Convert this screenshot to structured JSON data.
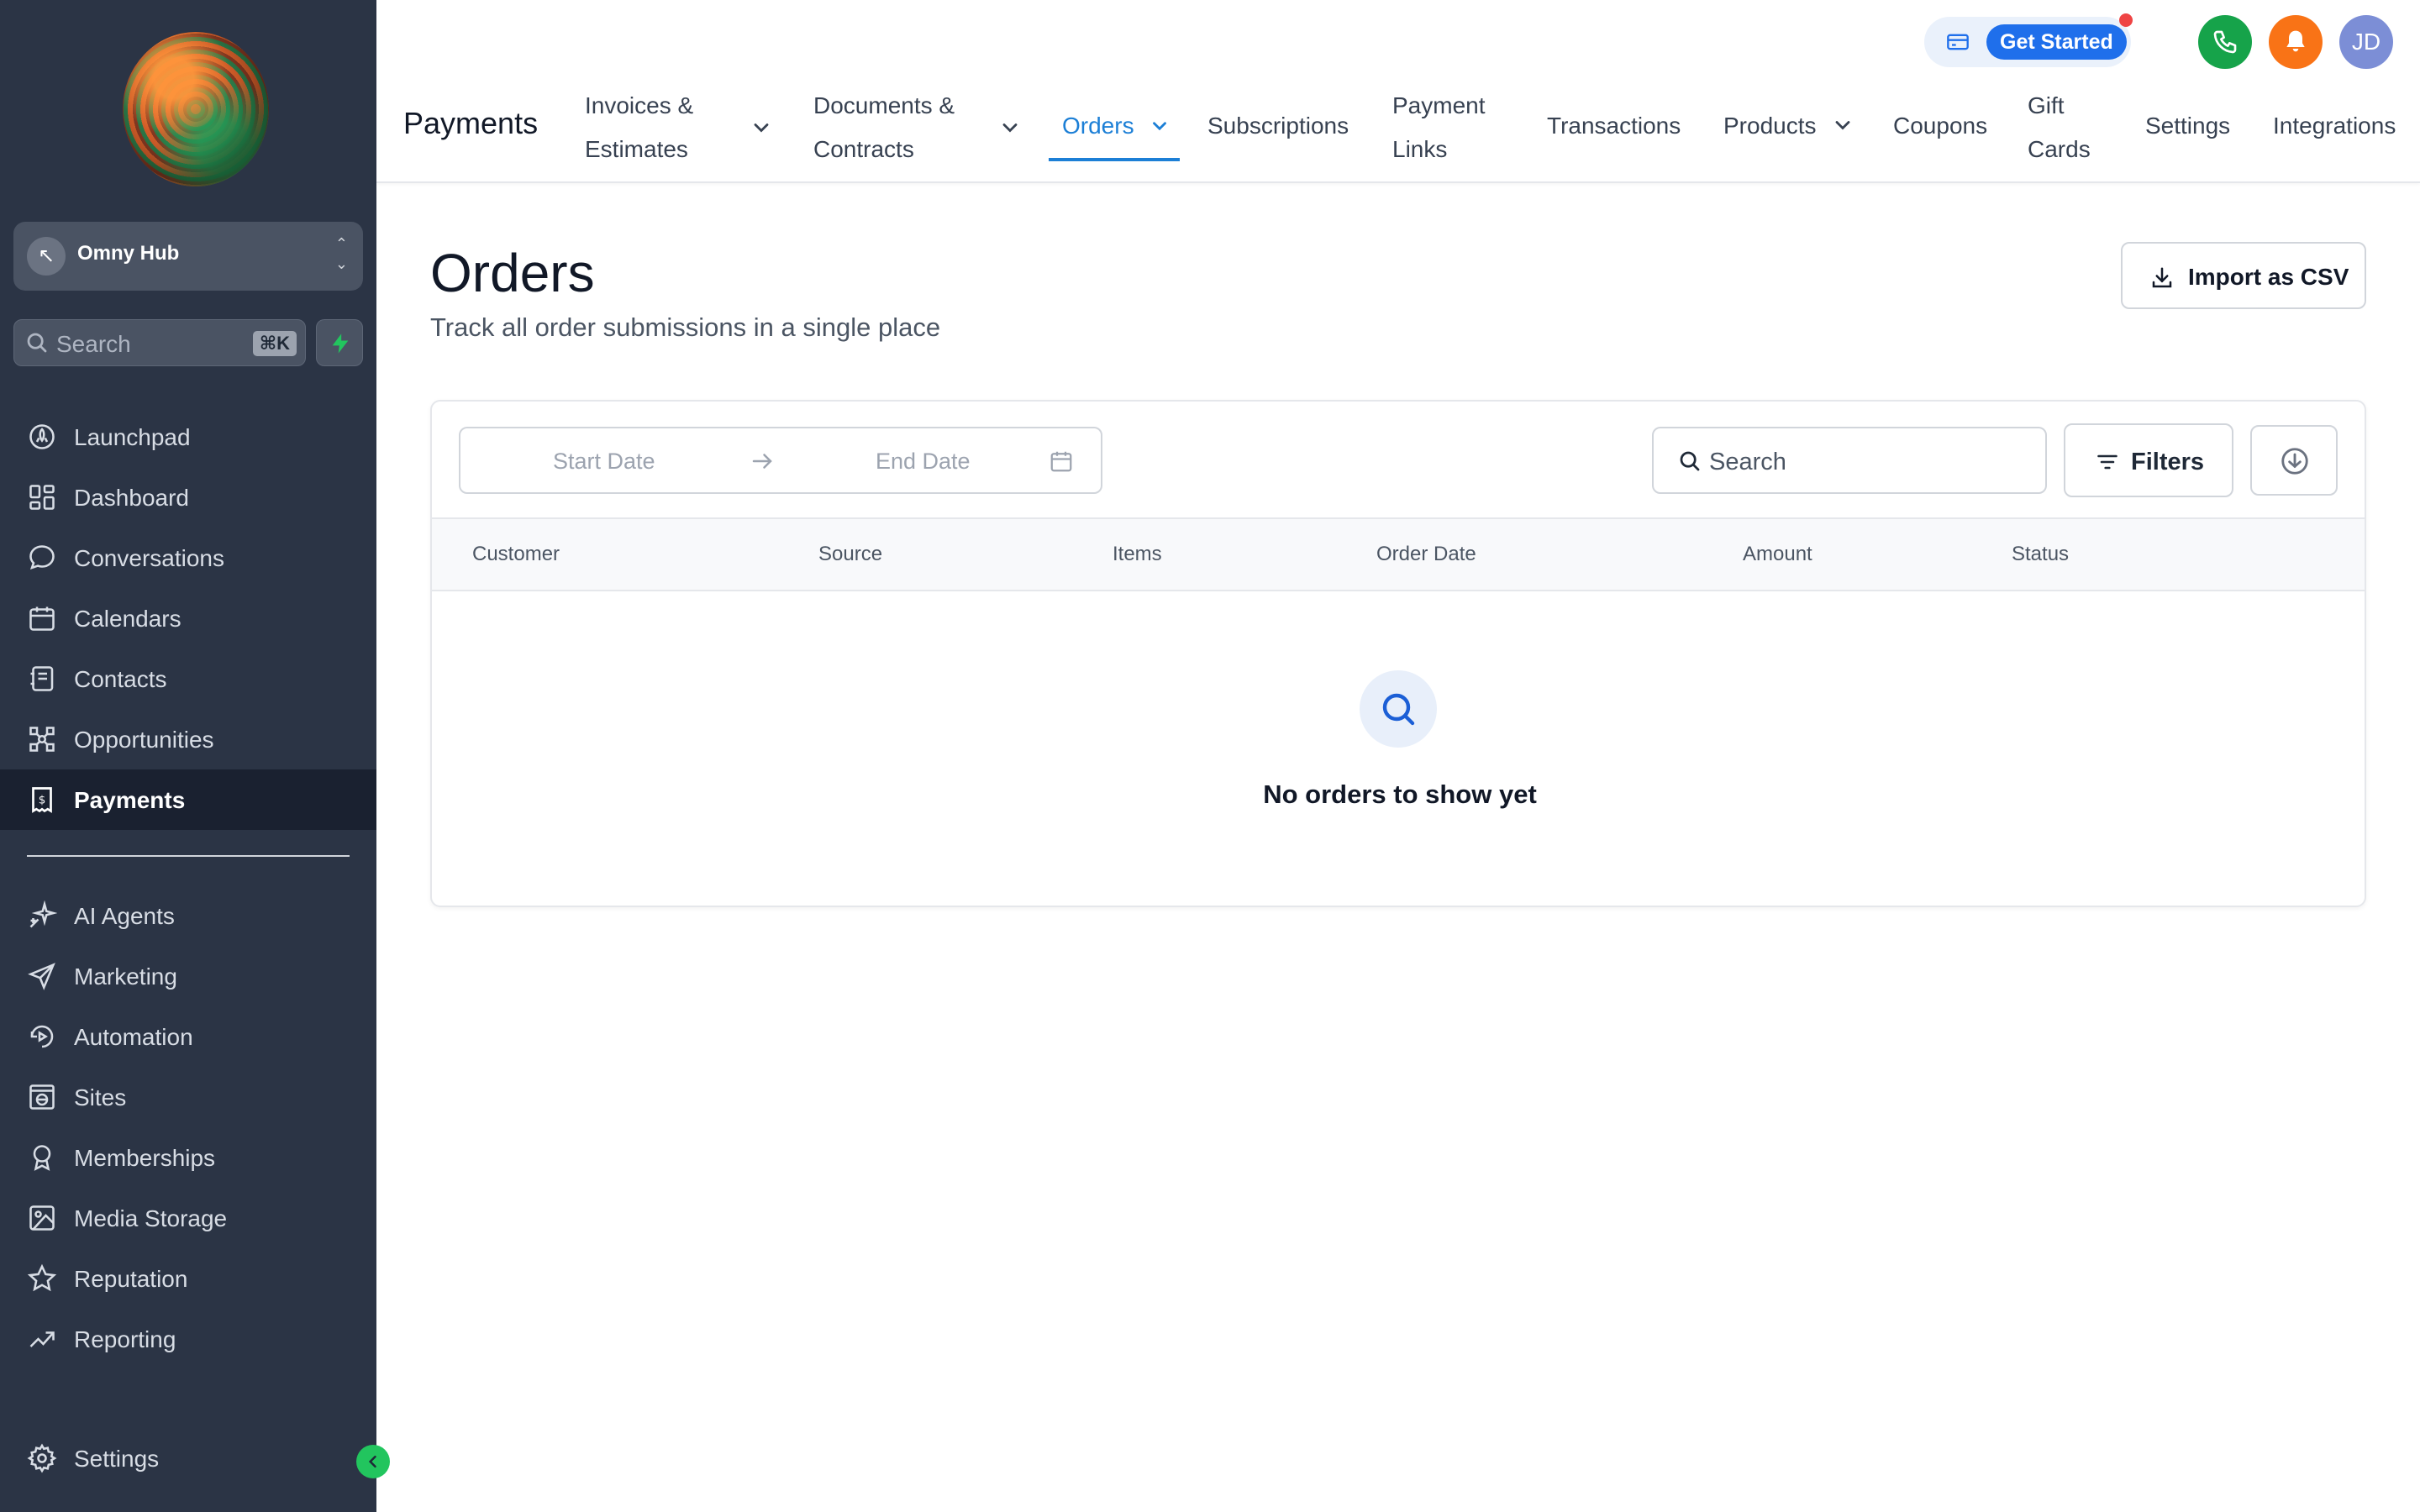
{
  "sidebar": {
    "account_initial": "↖",
    "account_name": "Omny Hub",
    "search_placeholder": "Search",
    "search_shortcut": "⌘K",
    "items_top": [
      {
        "label": "Launchpad",
        "icon": "rocket-icon"
      },
      {
        "label": "Dashboard",
        "icon": "dashboard-grid-icon"
      },
      {
        "label": "Conversations",
        "icon": "chat-bubble-icon"
      },
      {
        "label": "Calendars",
        "icon": "calendar-icon"
      },
      {
        "label": "Contacts",
        "icon": "contacts-book-icon"
      },
      {
        "label": "Opportunities",
        "icon": "opportunities-icon"
      },
      {
        "label": "Payments",
        "icon": "payments-receipt-icon",
        "active": true
      }
    ],
    "items_bottom": [
      {
        "label": "AI Agents",
        "icon": "sparkle-icon"
      },
      {
        "label": "Marketing",
        "icon": "send-icon"
      },
      {
        "label": "Automation",
        "icon": "automation-icon"
      },
      {
        "label": "Sites",
        "icon": "globe-window-icon"
      },
      {
        "label": "Memberships",
        "icon": "award-icon"
      },
      {
        "label": "Media Storage",
        "icon": "image-icon"
      },
      {
        "label": "Reputation",
        "icon": "star-icon"
      },
      {
        "label": "Reporting",
        "icon": "trending-up-icon"
      }
    ],
    "settings_label": "Settings"
  },
  "header": {
    "get_started": "Get Started",
    "avatar_initials": "JD",
    "section_title": "Payments",
    "tabs": [
      {
        "line1": "Invoices &",
        "line2": "Estimates",
        "dropdown": true
      },
      {
        "line1": "Documents &",
        "line2": "Contracts",
        "dropdown": true
      },
      {
        "label": "Orders",
        "dropdown": true,
        "active": true
      },
      {
        "label": "Subscriptions"
      },
      {
        "line1": "Payment",
        "line2": "Links"
      },
      {
        "label": "Transactions"
      },
      {
        "label": "Products",
        "dropdown": true
      },
      {
        "label": "Coupons"
      },
      {
        "line1": "Gift",
        "line2": "Cards"
      },
      {
        "label": "Settings"
      },
      {
        "label": "Integrations"
      }
    ]
  },
  "main": {
    "title": "Orders",
    "subtitle": "Track all order submissions in a single place",
    "import_button": "Import as CSV",
    "filters": {
      "start_date_placeholder": "Start Date",
      "end_date_placeholder": "End Date",
      "search_placeholder": "Search",
      "filters_button": "Filters"
    },
    "table": {
      "columns": [
        "Customer",
        "Source",
        "Items",
        "Order Date",
        "Amount",
        "Status"
      ],
      "rows": []
    },
    "empty_state": "No orders to show yet"
  },
  "colors": {
    "sidebar_bg": "#2b3445",
    "accent": "#1c7fd6",
    "get_started": "#1f6feb",
    "phone": "#16a34a",
    "bell": "#f97316"
  }
}
